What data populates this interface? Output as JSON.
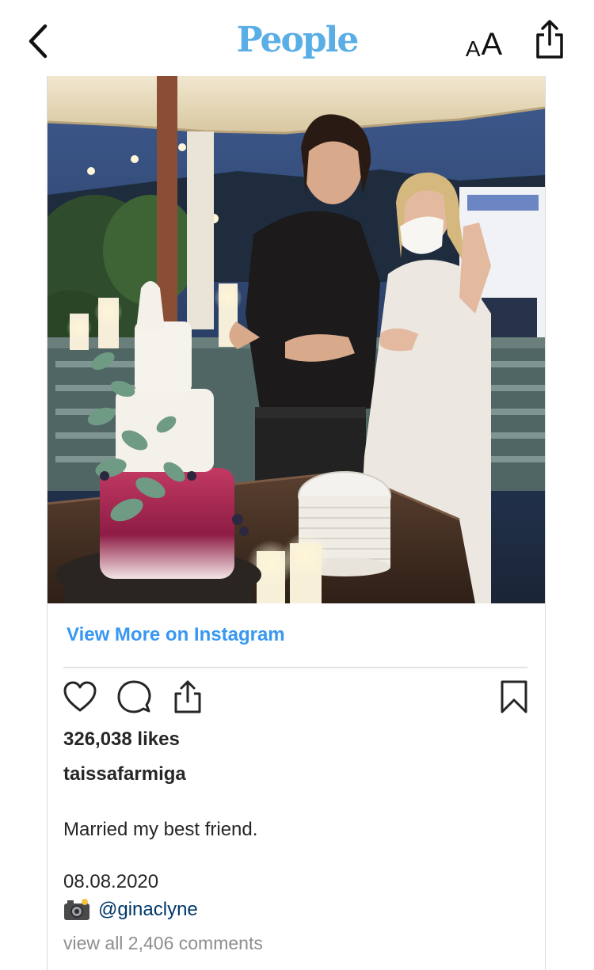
{
  "header": {
    "brand": "People",
    "text_size_small": "A",
    "text_size_large": "A",
    "brand_color": "#5aaee6"
  },
  "post": {
    "view_more_label": "View More on Instagram",
    "likes_text": "326,038 likes",
    "username": "taissafarmiga",
    "caption": "Married my best friend.",
    "date": "08.08.2020",
    "credit_handle": "@ginaclyne",
    "comments_link": "view all 2,406 comments",
    "link_color": "#3897f0"
  },
  "icons": {
    "back": "chevron-left-icon",
    "text_size": "text-size-icon",
    "share": "share-icon",
    "like": "heart-icon",
    "comment": "comment-icon",
    "post_share": "share-icon",
    "save": "bookmark-icon",
    "camera": "camera-icon"
  }
}
